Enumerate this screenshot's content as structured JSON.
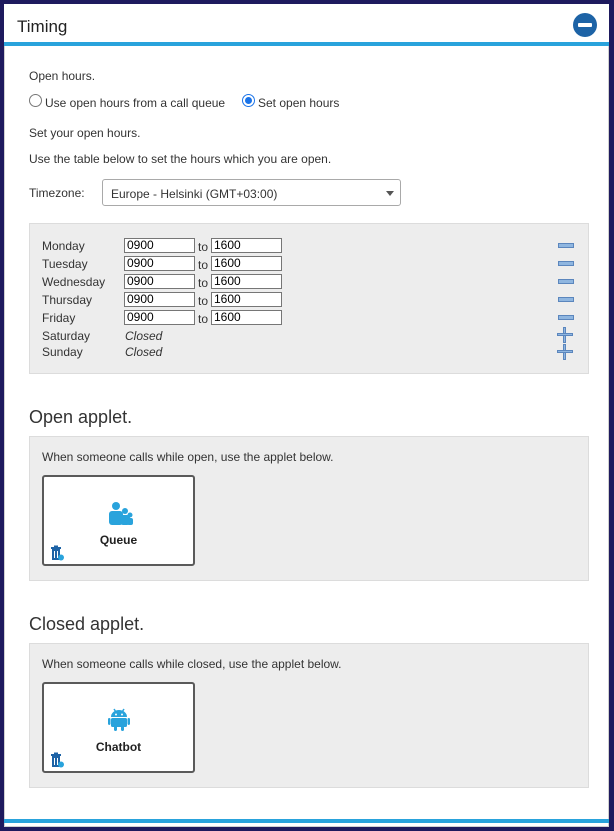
{
  "header": {
    "title": "Timing"
  },
  "open_hours": {
    "heading": "Open hours.",
    "option_call_queue": "Use open hours from a call queue",
    "option_set": "Set open hours",
    "selected": "Set open hours",
    "set_text": "Set your open hours.",
    "table_text": "Use the table below to set the hours which you are open.",
    "timezone_label": "Timezone:",
    "timezone_value": "Europe - Helsinki (GMT+03:00)"
  },
  "days": [
    {
      "name": "Monday",
      "from": "0900",
      "to_label": "to",
      "to": "1600"
    },
    {
      "name": "Tuesday",
      "from": "0900",
      "to_label": "to",
      "to": "1600"
    },
    {
      "name": "Wednesday",
      "from": "0900",
      "to_label": "to",
      "to": "1600"
    },
    {
      "name": "Thursday",
      "from": "0900",
      "to_label": "to",
      "to": "1600"
    },
    {
      "name": "Friday",
      "from": "0900",
      "to_label": "to",
      "to": "1600"
    },
    {
      "name": "Saturday",
      "status": "Closed"
    },
    {
      "name": "Sunday",
      "status": "Closed"
    }
  ],
  "open_applet": {
    "heading": "Open applet.",
    "text": "When someone calls while open, use the applet below.",
    "applet_label": "Queue",
    "icon": "queue-people-icon"
  },
  "closed_applet": {
    "heading": "Closed applet.",
    "text": "When someone calls while closed, use the applet below.",
    "applet_label": "Chatbot",
    "icon": "android-robot-icon"
  },
  "colors": {
    "accent": "#29a3dc",
    "collapse_button": "#1d63a6",
    "radio": "#1a73e8"
  }
}
